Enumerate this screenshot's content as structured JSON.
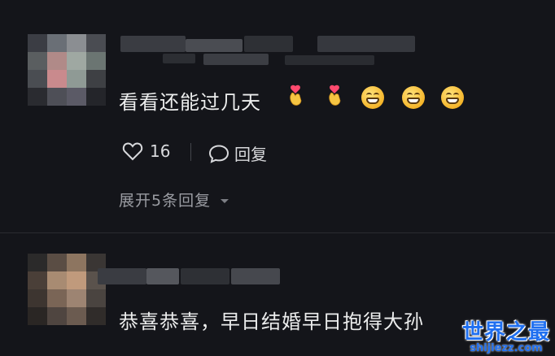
{
  "comment1": {
    "text": "看看还能过几天",
    "likes": "16",
    "reply_label": "回复",
    "expand_label": "展开5条回复"
  },
  "comment2": {
    "text": "恭喜恭喜，早日结婚早日抱得大孙"
  },
  "watermark": {
    "title": "世界之最",
    "url": "shijiezz.com"
  },
  "icons": {
    "like": "heart-outline-icon",
    "reply": "chat-bubble-icon",
    "expand": "chevron-down-icon"
  },
  "colors": {
    "background": "#14151a",
    "watermark": "#1f6ff0"
  }
}
